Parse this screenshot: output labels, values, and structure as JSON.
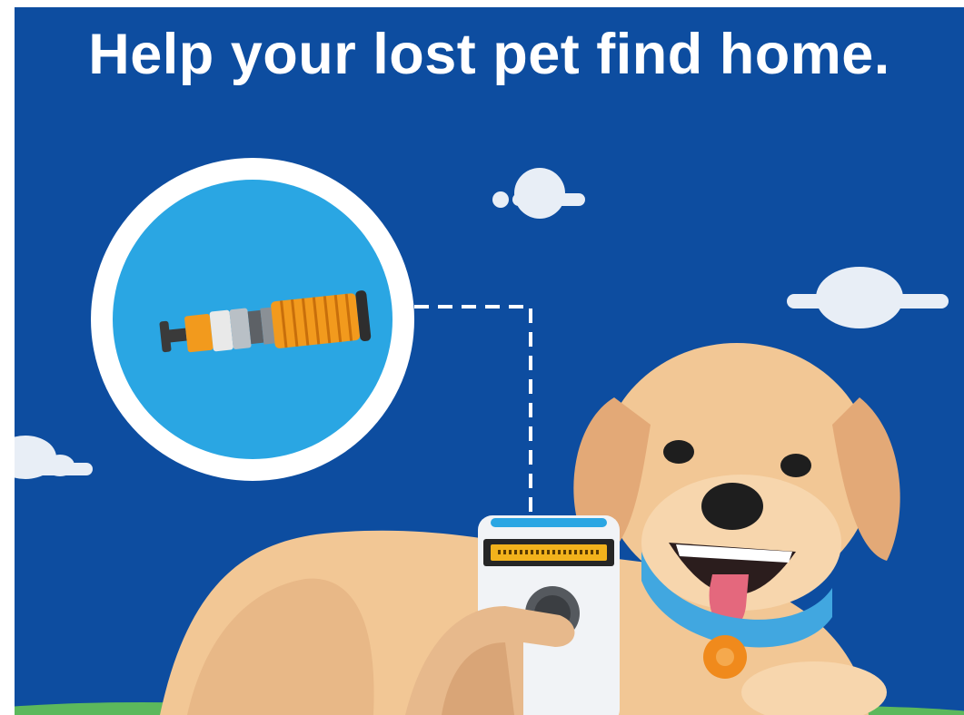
{
  "headline": "Help your lost pet find home.",
  "colors": {
    "background": "#0d4da0",
    "headline": "#ffffff",
    "cloud": "#e8eef6",
    "grass": "#5cb85c",
    "dog_fur": "#f2c795",
    "dog_fur_shadow": "#e3a977",
    "collar": "#41a7e0",
    "tag": "#f08a1c",
    "tongue": "#e4687d",
    "scanner_body": "#f1f3f6",
    "scanner_display": "#f2b21c",
    "microchip_badge": "#2aa6e3",
    "hand": "#e7b98c"
  },
  "icons": [
    "cloud-icon",
    "microchip-icon",
    "microchip-scanner-icon",
    "dog-illustration",
    "pet-tag-icon"
  ]
}
